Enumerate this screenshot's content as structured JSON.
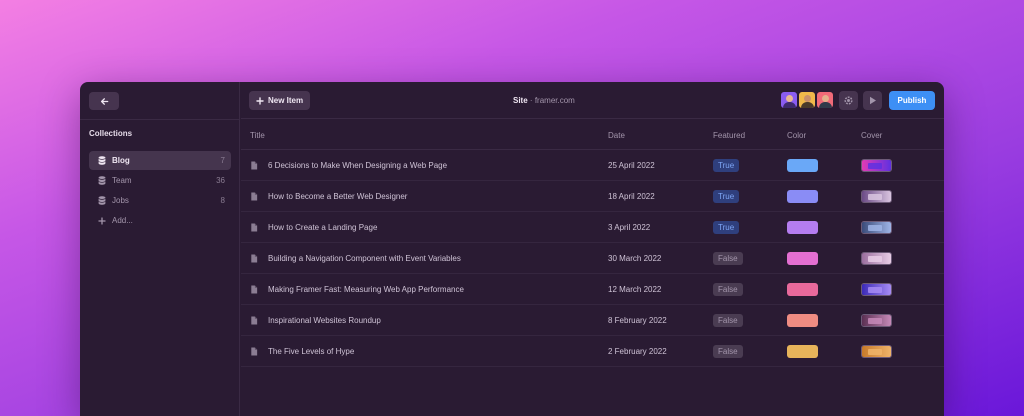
{
  "sidebar": {
    "collections_title": "Collections",
    "items": [
      {
        "label": "Blog",
        "count": "7"
      },
      {
        "label": "Team",
        "count": "36"
      },
      {
        "label": "Jobs",
        "count": "8"
      },
      {
        "label": "Add...",
        "count": ""
      }
    ]
  },
  "topbar": {
    "new_item_label": "New Item",
    "site_name": "Site",
    "site_separator": "·",
    "site_domain": "framer.com",
    "publish_label": "Publish"
  },
  "table": {
    "headers": {
      "title": "Title",
      "date": "Date",
      "featured": "Featured",
      "color": "Color",
      "cover": "Cover"
    },
    "rows": [
      {
        "title": "6 Decisions to Make When Designing a Web Page",
        "date": "25 April 2022",
        "featured": "True",
        "color": "#6aa8f7",
        "cover_a": "#e23bb5",
        "cover_b": "#5f30e0"
      },
      {
        "title": "How to Become a Better Web Designer",
        "date": "18 April 2022",
        "featured": "True",
        "color": "#8a8cf5",
        "cover_a": "#6b4a86",
        "cover_b": "#d9c5e0"
      },
      {
        "title": "How to Create a Landing Page",
        "date": "3 April 2022",
        "featured": "True",
        "color": "#b57df0",
        "cover_a": "#3a4b7a",
        "cover_b": "#9fb4e6"
      },
      {
        "title": "Building a Navigation Component with Event Variables",
        "date": "30 March 2022",
        "featured": "False",
        "color": "#e36fd1",
        "cover_a": "#9a6e9e",
        "cover_b": "#e8cde6"
      },
      {
        "title": "Making Framer Fast: Measuring Web App Performance",
        "date": "12 March 2022",
        "featured": "False",
        "color": "#e8699b",
        "cover_a": "#3b2ab8",
        "cover_b": "#a78cf5"
      },
      {
        "title": "Inspirational Websites Roundup",
        "date": "8 February 2022",
        "featured": "False",
        "color": "#ef8c82",
        "cover_a": "#5a2f52",
        "cover_b": "#c68ab8"
      },
      {
        "title": "The Five Levels of Hype",
        "date": "2 February 2022",
        "featured": "False",
        "color": "#e7b45a",
        "cover_a": "#c77a2a",
        "cover_b": "#f0b46a"
      }
    ]
  },
  "colors": {
    "accent": "#3d8ff5",
    "window_bg": "#2a1b33"
  },
  "icons": {
    "back": "arrow-left-icon",
    "collection": "database-icon",
    "add": "plus-icon",
    "settings": "gear-icon",
    "preview": "play-icon",
    "document": "document-icon"
  }
}
